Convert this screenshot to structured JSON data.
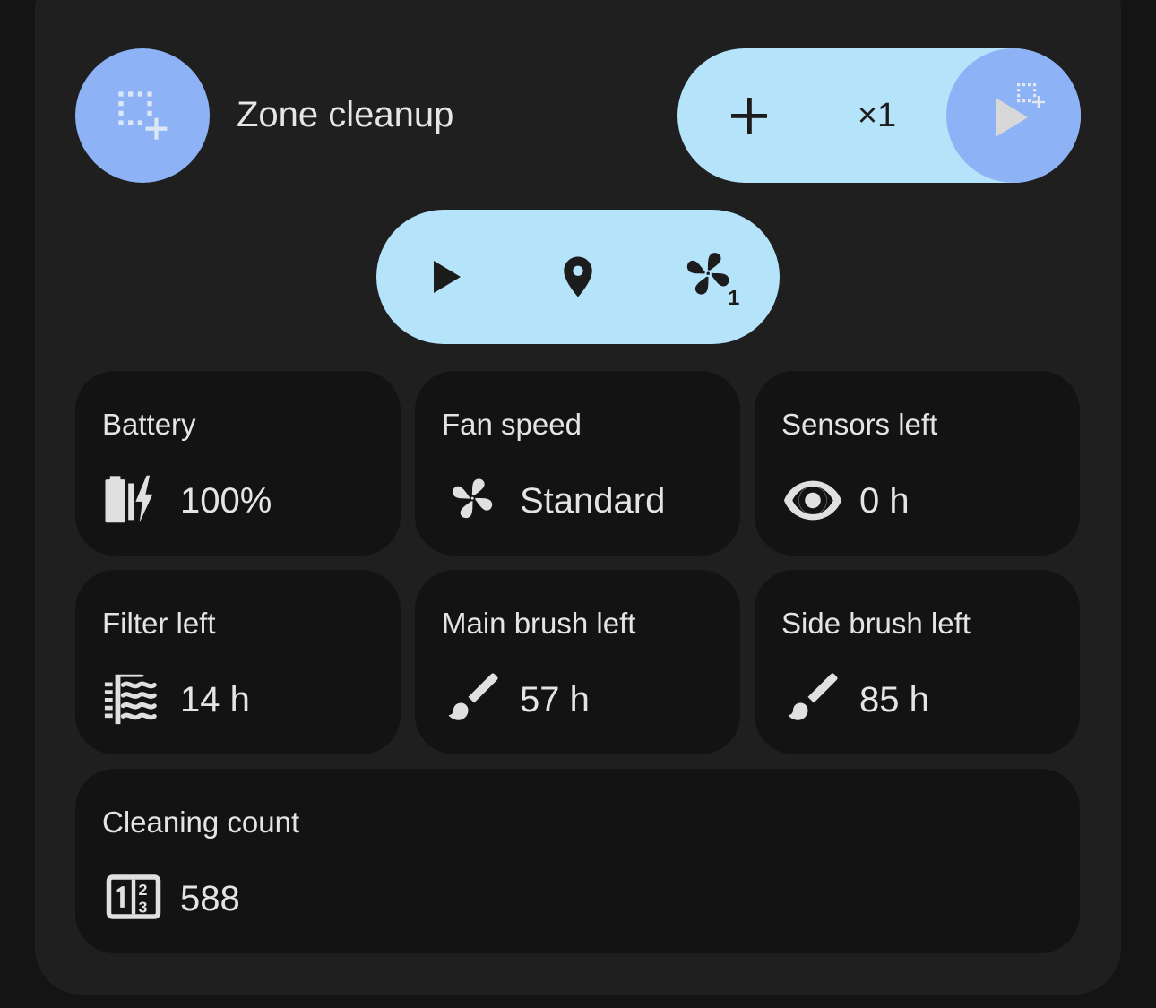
{
  "zone": {
    "title": "Zone cleanup",
    "repeat_label": "×1",
    "icon": "zone-select-icon"
  },
  "actions": {
    "start_icon": "play-icon",
    "locate_icon": "map-marker-icon",
    "fan_icon": "fan-speed-icon",
    "fan_level": "1"
  },
  "tiles": [
    {
      "label": "Battery",
      "value": "100%",
      "icon": "battery-charging-icon"
    },
    {
      "label": "Fan speed",
      "value": "Standard",
      "icon": "fan-icon"
    },
    {
      "label": "Sensors left",
      "value": "0 h",
      "icon": "eye-icon"
    },
    {
      "label": "Filter left",
      "value": "14 h",
      "icon": "air-filter-icon"
    },
    {
      "label": "Main brush left",
      "value": "57 h",
      "icon": "brush-icon"
    },
    {
      "label": "Side brush left",
      "value": "85 h",
      "icon": "brush-icon"
    },
    {
      "label": "Cleaning count",
      "value": "588",
      "icon": "counter-icon"
    }
  ],
  "colors": {
    "background": "#141414",
    "card": "#1f1f1f",
    "tile": "#131313",
    "accent_light": "#b4e3fa",
    "accent_blue": "#8db2f5",
    "text": "#e4e4e4"
  }
}
